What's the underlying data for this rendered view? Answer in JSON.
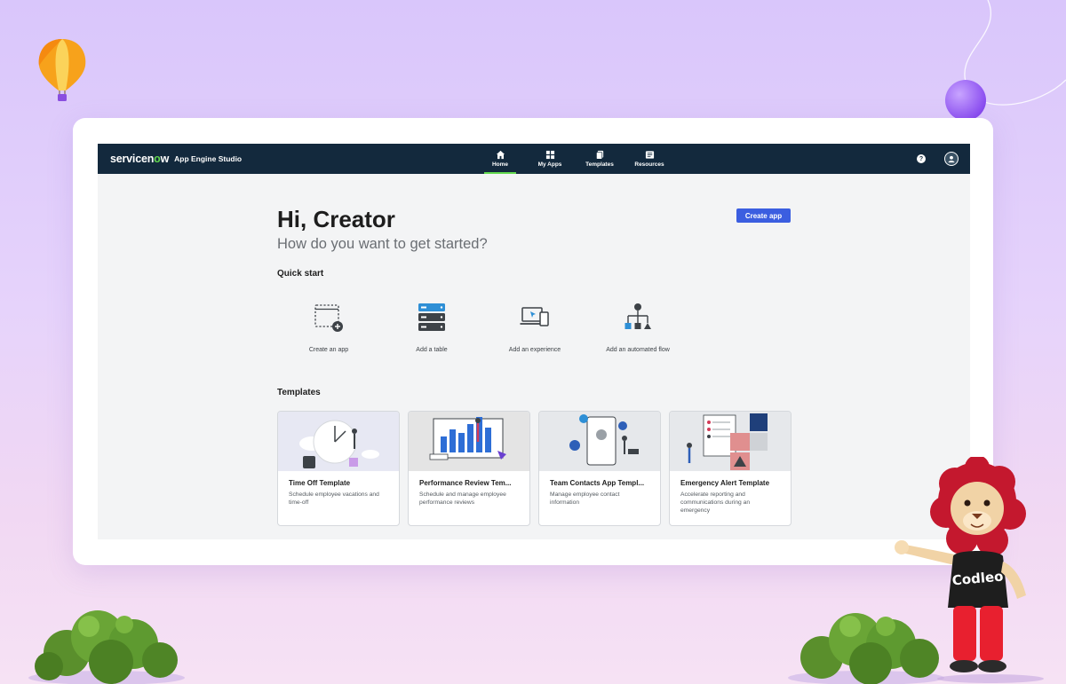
{
  "app": {
    "brand": "servicenow",
    "product": "App Engine Studio"
  },
  "nav": [
    {
      "label": "Home",
      "icon": "home-icon",
      "active": true
    },
    {
      "label": "My Apps",
      "icon": "grid-icon",
      "active": false
    },
    {
      "label": "Templates",
      "icon": "templates-icon",
      "active": false
    },
    {
      "label": "Resources",
      "icon": "resources-icon",
      "active": false
    }
  ],
  "header": {
    "help_icon": "help-icon",
    "help_glyph": "?",
    "avatar_icon": "user-avatar-icon"
  },
  "main": {
    "greeting": "Hi, Creator",
    "subtitle": "How do you want to get started?",
    "create_app_label": "Create app",
    "quick_start_title": "Quick start",
    "quick_start": [
      {
        "label": "Create an app",
        "icon": "create-app-icon"
      },
      {
        "label": "Add a table",
        "icon": "table-icon"
      },
      {
        "label": "Add an experience",
        "icon": "experience-icon"
      },
      {
        "label": "Add an automated flow",
        "icon": "flow-icon"
      }
    ],
    "templates_title": "Templates",
    "templates": [
      {
        "title": "Time Off Template",
        "desc": "Schedule employee vacations and time-off"
      },
      {
        "title": "Performance Review Tem...",
        "desc": "Schedule and manage employee performance reviews"
      },
      {
        "title": "Team Contacts App Templ...",
        "desc": "Manage employee contact information"
      },
      {
        "title": "Emergency Alert Template",
        "desc": "Accelerate reporting and communications during an emergency"
      }
    ]
  },
  "mascot": {
    "shirt_text": "Codleo"
  },
  "colors": {
    "topbar": "#13293d",
    "accent_green": "#62d84e",
    "button_blue": "#3b5ee0",
    "icon_blue": "#2e8fd6"
  }
}
